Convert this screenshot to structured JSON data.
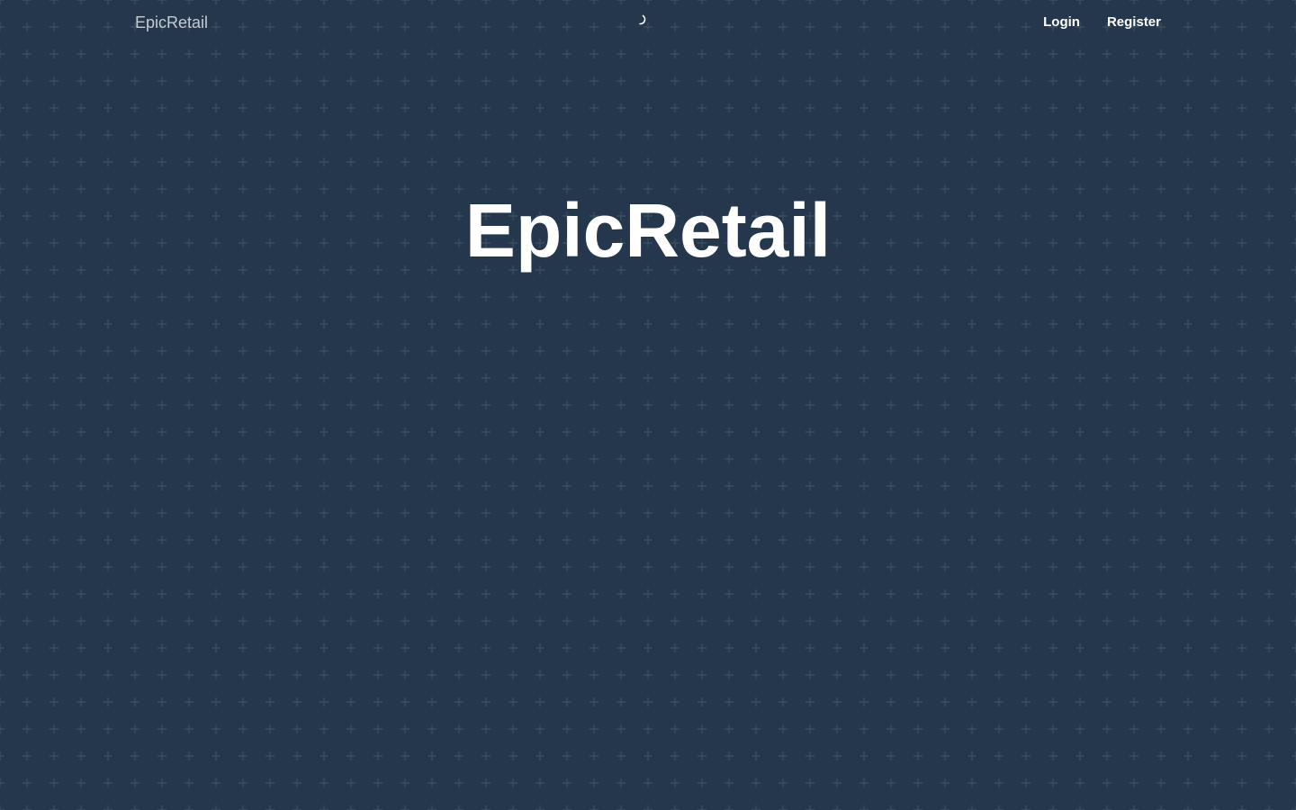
{
  "colors": {
    "background": "#24374c",
    "pattern_plus": "#3b4d60",
    "brand_text": "#c5ccd4",
    "nav_text": "#ffffff",
    "hero_text": "#ffffff"
  },
  "navbar": {
    "brand": "EpicRetail",
    "loading_icon": "spinner-icon",
    "links": [
      {
        "label": "Login"
      },
      {
        "label": "Register"
      }
    ]
  },
  "hero": {
    "title": "EpicRetail"
  },
  "background": {
    "pattern_icon": "plus-icon"
  }
}
